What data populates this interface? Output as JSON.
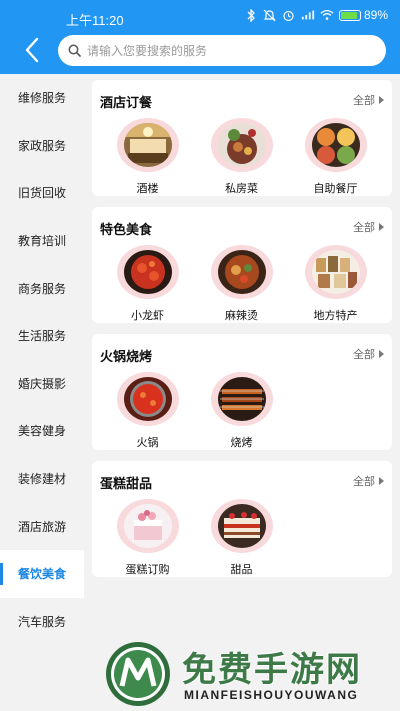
{
  "status": {
    "time": "上午11:20",
    "battery": "89%"
  },
  "search": {
    "placeholder": "请输入您要搜索的服务"
  },
  "sidebar": {
    "items": [
      {
        "label": "维修服务"
      },
      {
        "label": "家政服务"
      },
      {
        "label": "旧货回收"
      },
      {
        "label": "教育培训"
      },
      {
        "label": "商务服务"
      },
      {
        "label": "生活服务"
      },
      {
        "label": "婚庆摄影"
      },
      {
        "label": "美容健身"
      },
      {
        "label": "装修建材"
      },
      {
        "label": "酒店旅游"
      },
      {
        "label": "餐饮美食"
      },
      {
        "label": "汽车服务"
      }
    ],
    "active": "餐饮美食"
  },
  "sections": [
    {
      "title": "酒店订餐",
      "all": "全部",
      "items": [
        {
          "label": "酒楼"
        },
        {
          "label": "私房菜"
        },
        {
          "label": "自助餐厅"
        }
      ]
    },
    {
      "title": "特色美食",
      "all": "全部",
      "items": [
        {
          "label": "小龙虾"
        },
        {
          "label": "麻辣烫"
        },
        {
          "label": "地方特产"
        }
      ]
    },
    {
      "title": "火锅烧烤",
      "all": "全部",
      "items": [
        {
          "label": "火锅"
        },
        {
          "label": "烧烤"
        }
      ]
    },
    {
      "title": "蛋糕甜品",
      "all": "全部",
      "items": [
        {
          "label": "蛋糕订购"
        },
        {
          "label": "甜品"
        }
      ]
    }
  ],
  "watermark": {
    "title": "免费手游网",
    "subtitle": "MIANFEISHOUYOUWANG"
  },
  "colors": {
    "header": "#2196f3",
    "accent": "#1e88e5",
    "thumb_ring": "#f8dadc"
  }
}
